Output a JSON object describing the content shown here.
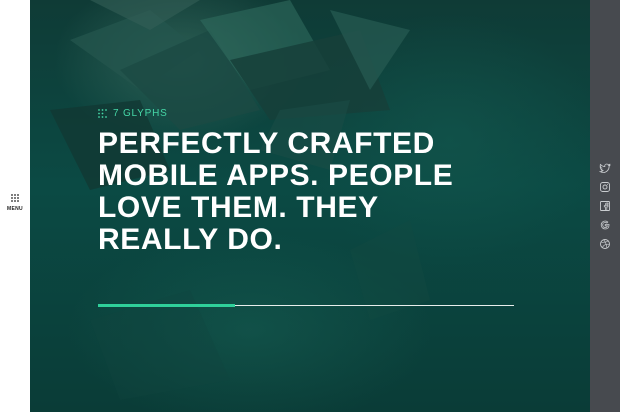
{
  "nav": {
    "menu_label": "MENU",
    "menu_icon": "menu-dots-icon"
  },
  "brand": {
    "name": "7 GLYPHS",
    "icon": "glyph-dots-icon",
    "color": "#45d6a6"
  },
  "hero": {
    "headline": "PERFECTLY CRAFTED\nMOBILE APPS. PEOPLE\nLOVE THEM. THEY\nREALLY DO.",
    "progress": 0.33,
    "accent_color": "#2fd09a",
    "background_color": "#0b4a44"
  },
  "social": {
    "background_color": "#474a4f",
    "items": [
      "twitter-icon",
      "instagram-icon",
      "facebook-icon",
      "google-icon",
      "dribbble-icon"
    ]
  }
}
